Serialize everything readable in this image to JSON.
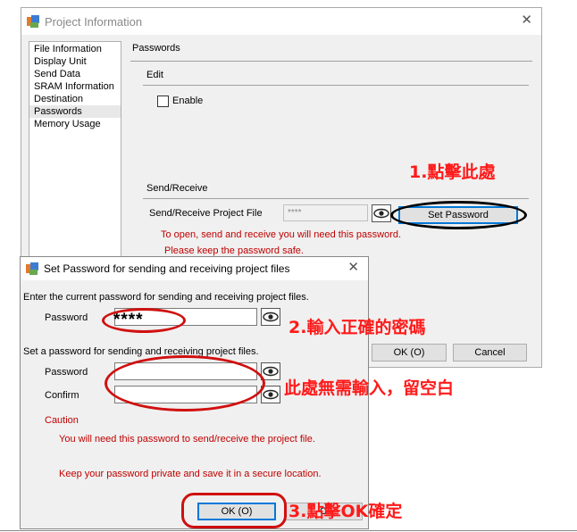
{
  "main_window": {
    "title": "Project Information",
    "nav_items": [
      {
        "label": "File Information"
      },
      {
        "label": "Display Unit"
      },
      {
        "label": "Send Data"
      },
      {
        "label": "SRAM Information"
      },
      {
        "label": "Destination"
      },
      {
        "label": "Passwords"
      },
      {
        "label": "Memory Usage"
      }
    ],
    "selected_nav": "Passwords",
    "section_title": "Passwords",
    "edit_group": "Edit",
    "enable_label": "Enable",
    "enable_checked": false,
    "sendreceive_group": "Send/Receive",
    "project_file_label": "Send/Receive Project File",
    "project_file_value": "****",
    "set_password_button": "Set Password",
    "info_line1": "To open, send and receive you will need this password.",
    "info_line2": "Please keep the password safe.",
    "ok_button": "OK (O)",
    "cancel_button": "Cancel"
  },
  "dialog": {
    "title": "Set Password for sending and receiving project files",
    "current_prompt": "Enter the current password for sending and receiving project files.",
    "current_password_label": "Password",
    "current_password_value": "****",
    "new_prompt": "Set a password for sending and receiving project files.",
    "new_password_label": "Password",
    "new_password_value": "",
    "confirm_label": "Confirm",
    "confirm_value": "",
    "caution_label": "Caution",
    "caution_line1": "You will need this password to send/receive the project file.",
    "caution_line2": "Keep your password private and save it in a secure location.",
    "ok_button": "OK (O)",
    "cancel_button_partial": "C"
  },
  "annotations": {
    "step1": "1.點擊此處",
    "step2": "2.輸入正確的密碼",
    "note": "此處無需輸入，留空白",
    "step3": "3.點擊OK確定"
  },
  "colors": {
    "annotation_red": "#ff1a1a",
    "ring_red": "#d01010",
    "ring_black": "#000000",
    "info_red": "#c00000",
    "default_button_border": "#0078d7"
  },
  "icons": [
    "app-icon",
    "close-icon",
    "eye-icon",
    "checkbox-icon"
  ]
}
